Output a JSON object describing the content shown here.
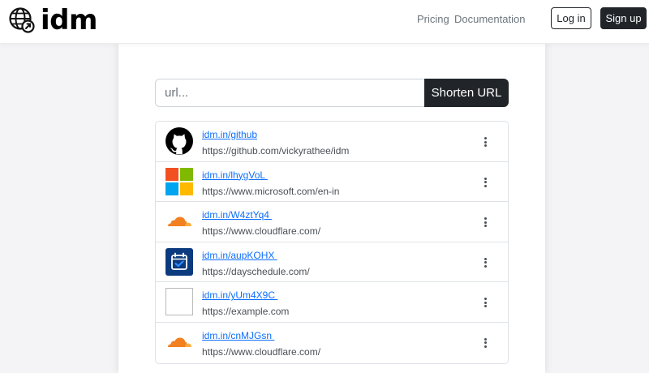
{
  "brand": {
    "name": "idm",
    "icon": "globe-link-icon"
  },
  "nav": {
    "links": [
      "Pricing",
      "Documentation"
    ],
    "login_label": "Log in",
    "signup_label": "Sign up"
  },
  "shortener": {
    "placeholder": "url...",
    "button_label": "Shorten URL"
  },
  "links": [
    {
      "short": "idm.in/github",
      "url": "https://github.com/vickyrathee/idm",
      "icon": "github-icon"
    },
    {
      "short": "idm.in/lhygVoL ",
      "url": "https://www.microsoft.com/en-in",
      "icon": "microsoft-icon"
    },
    {
      "short": "idm.in/W4ztYq4 ",
      "url": "https://www.cloudflare.com/",
      "icon": "cloudflare-icon"
    },
    {
      "short": "idm.in/aupKOHX ",
      "url": "https://dayschedule.com/",
      "icon": "calendar-check-icon"
    },
    {
      "short": "idm.in/yUm4X9C ",
      "url": "https://example.com",
      "icon": "broken-image-icon"
    },
    {
      "short": "idm.in/cnMJGsn ",
      "url": "https://www.cloudflare.com/",
      "icon": "cloudflare-icon"
    }
  ],
  "colors": {
    "primary_dark": "#212529",
    "link": "#0d6efd",
    "cloudflare": "#f38020",
    "dayschedule": "#0b3a7e",
    "ms_red": "#f25022",
    "ms_green": "#7fba00",
    "ms_blue": "#00a4ef",
    "ms_yellow": "#ffb900"
  }
}
